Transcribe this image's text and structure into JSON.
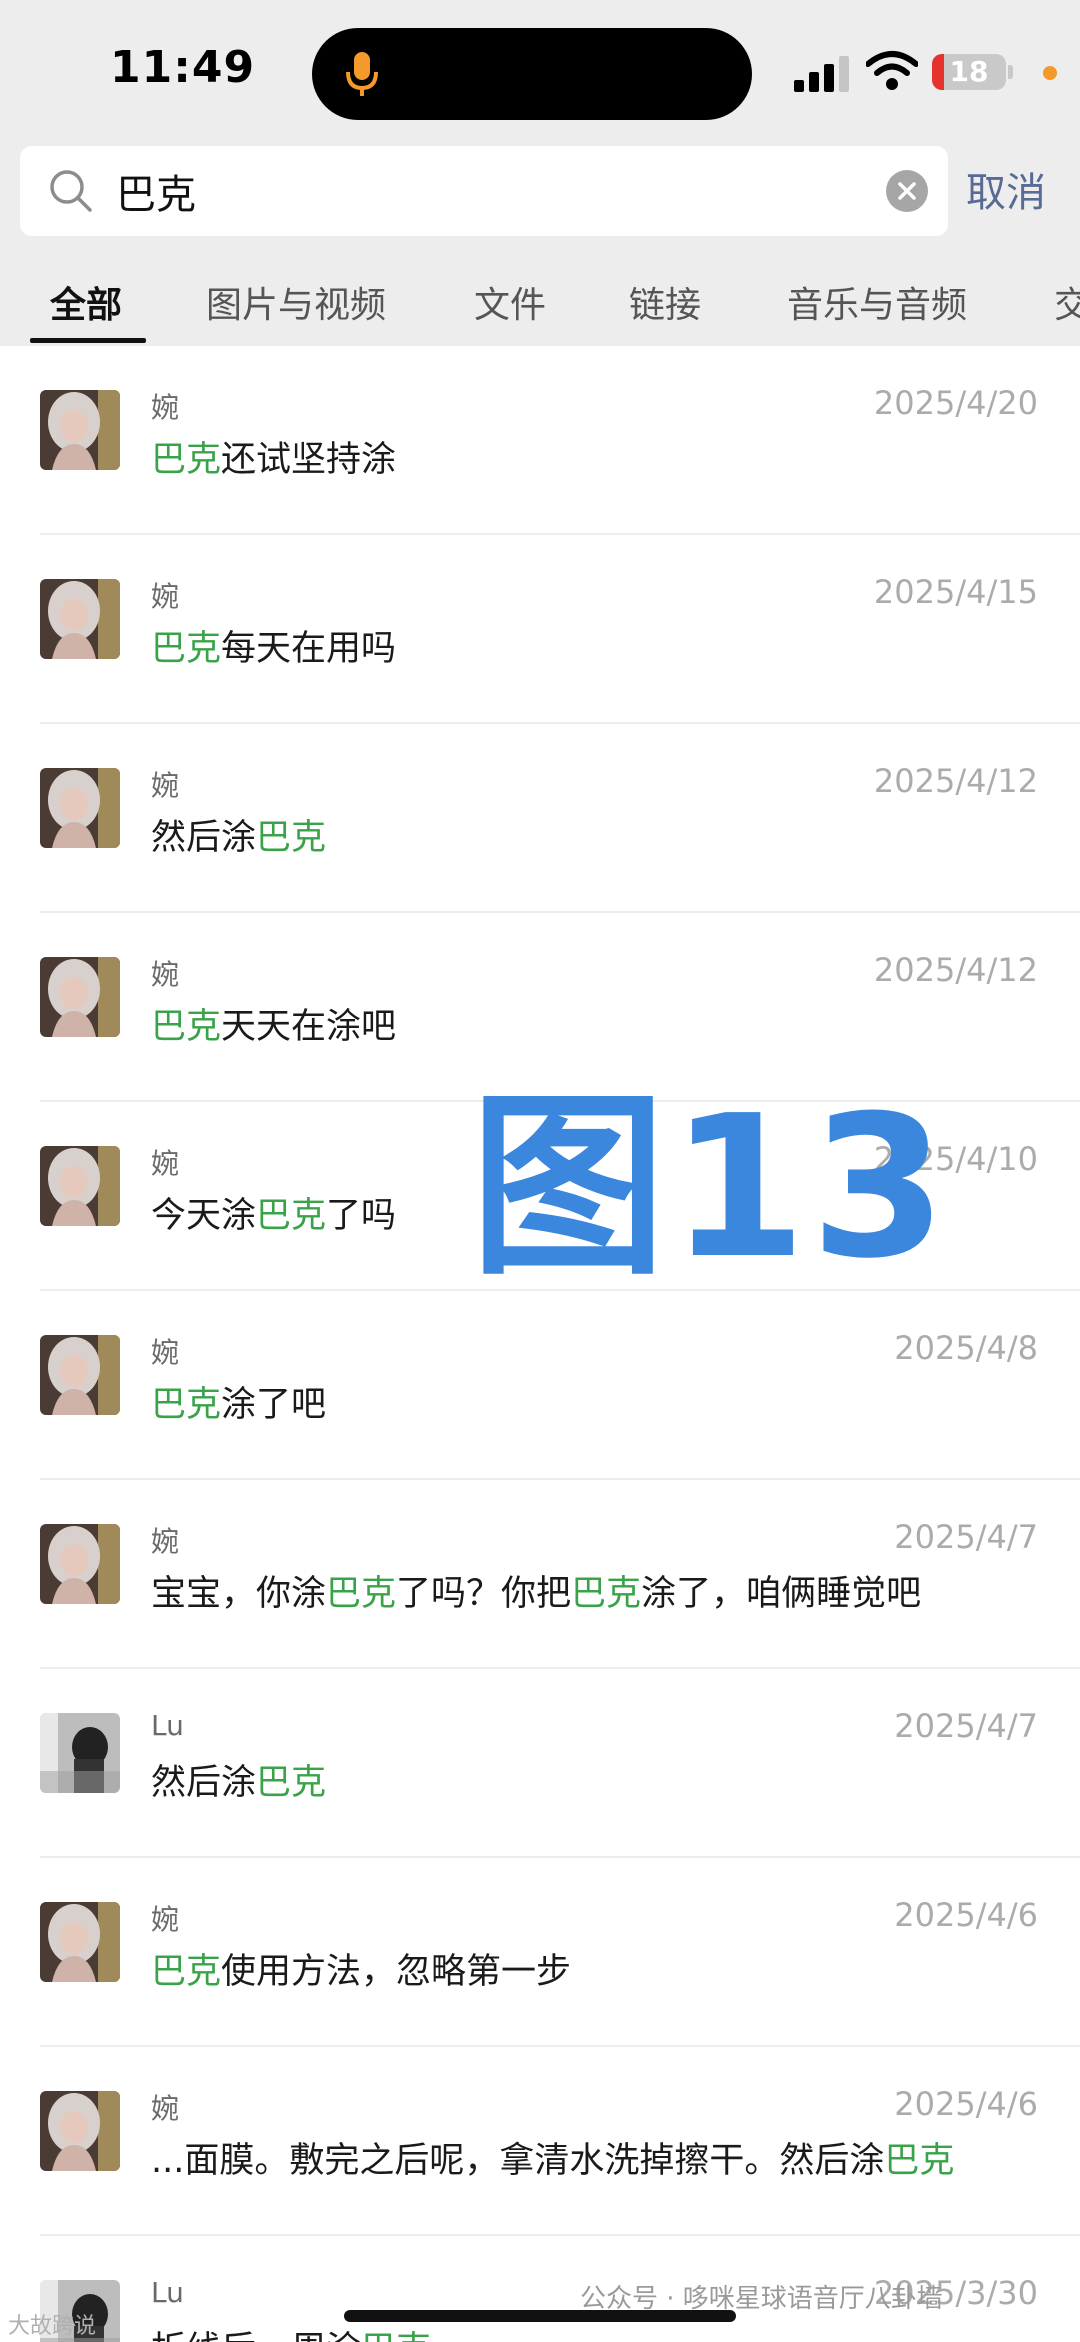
{
  "status_bar": {
    "time": "11:49",
    "battery_level": "18",
    "battery_color": "#e5322d"
  },
  "search": {
    "query": "巴克",
    "cancel_label": "取消"
  },
  "tabs": [
    {
      "label": "全部",
      "active": true
    },
    {
      "label": "图片与视频",
      "active": false
    },
    {
      "label": "文件",
      "active": false
    },
    {
      "label": "链接",
      "active": false
    },
    {
      "label": "音乐与音频",
      "active": false
    },
    {
      "label": "交",
      "active": false
    }
  ],
  "keyword_color": "#3aa34a",
  "results": [
    {
      "sender": "婉",
      "date": "2025/4/20",
      "parts": [
        {
          "t": "巴克",
          "hl": true
        },
        {
          "t": "还试坚持涂",
          "hl": false
        }
      ]
    },
    {
      "sender": "婉",
      "date": "2025/4/15",
      "parts": [
        {
          "t": "巴克",
          "hl": true
        },
        {
          "t": "每天在用吗",
          "hl": false
        }
      ]
    },
    {
      "sender": "婉",
      "date": "2025/4/12",
      "parts": [
        {
          "t": "然后涂",
          "hl": false
        },
        {
          "t": "巴克",
          "hl": true
        }
      ]
    },
    {
      "sender": "婉",
      "date": "2025/4/12",
      "parts": [
        {
          "t": "巴克",
          "hl": true
        },
        {
          "t": "天天在涂吧",
          "hl": false
        }
      ]
    },
    {
      "sender": "婉",
      "date": "2025/4/10",
      "parts": [
        {
          "t": "今天涂",
          "hl": false
        },
        {
          "t": "巴克",
          "hl": true
        },
        {
          "t": "了吗",
          "hl": false
        }
      ]
    },
    {
      "sender": "婉",
      "date": "2025/4/8",
      "parts": [
        {
          "t": "巴克",
          "hl": true
        },
        {
          "t": "涂了吧",
          "hl": false
        }
      ]
    },
    {
      "sender": "婉",
      "date": "2025/4/7",
      "parts": [
        {
          "t": "宝宝，你涂",
          "hl": false
        },
        {
          "t": "巴克",
          "hl": true
        },
        {
          "t": "了吗？你把",
          "hl": false
        },
        {
          "t": "巴克",
          "hl": true
        },
        {
          "t": "涂了，咱俩睡觉吧",
          "hl": false
        }
      ]
    },
    {
      "sender": "Lu",
      "date": "2025/4/7",
      "parts": [
        {
          "t": "然后涂",
          "hl": false
        },
        {
          "t": "巴克",
          "hl": true
        }
      ]
    },
    {
      "sender": "婉",
      "date": "2025/4/6",
      "parts": [
        {
          "t": "巴克",
          "hl": true
        },
        {
          "t": "使用方法，忽略第一步",
          "hl": false
        }
      ]
    },
    {
      "sender": "婉",
      "date": "2025/4/6",
      "parts": [
        {
          "t": "...面膜。敷完之后呢，拿清水洗掉擦干。然后涂",
          "hl": false
        },
        {
          "t": "巴克",
          "hl": true
        }
      ]
    },
    {
      "sender": "Lu",
      "date": "2025/3/30",
      "parts": [
        {
          "t": "折线后一周涂",
          "hl": false
        },
        {
          "t": "巴克",
          "hl": true
        }
      ]
    }
  ],
  "overlay_label": "图13",
  "footer_watermark": "公众号 · 哆咪星球语音厅八卦墙",
  "corner_watermark": "大故跨说"
}
